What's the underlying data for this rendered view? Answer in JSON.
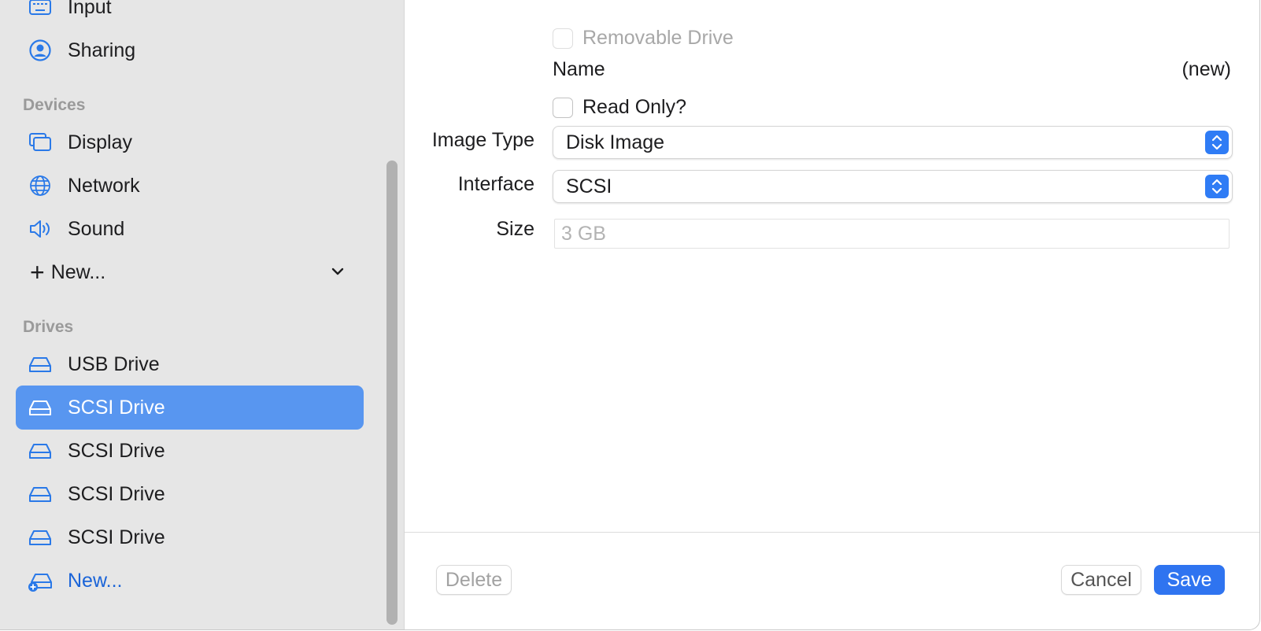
{
  "sidebar": {
    "items_top": [
      {
        "label": "Input",
        "icon": "keyboard-icon"
      },
      {
        "label": "Sharing",
        "icon": "person-circle-icon"
      }
    ],
    "devices_header": "Devices",
    "devices": [
      {
        "label": "Display",
        "icon": "display-icon"
      },
      {
        "label": "Network",
        "icon": "globe-icon"
      },
      {
        "label": "Sound",
        "icon": "speaker-icon"
      }
    ],
    "new_device_label": "New...",
    "drives_header": "Drives",
    "drives": [
      {
        "label": "USB Drive",
        "icon": "drive-icon",
        "selected": false
      },
      {
        "label": "SCSI Drive",
        "icon": "drive-icon",
        "selected": true
      },
      {
        "label": "SCSI Drive",
        "icon": "drive-icon",
        "selected": false
      },
      {
        "label": "SCSI Drive",
        "icon": "drive-icon",
        "selected": false
      },
      {
        "label": "SCSI Drive",
        "icon": "drive-icon",
        "selected": false
      }
    ],
    "new_drive_label": "New..."
  },
  "form": {
    "removable_label": "Removable Drive",
    "removable_checked": false,
    "name_label": "Name",
    "name_value": "(new)",
    "read_only_label": "Read Only?",
    "read_only_checked": false,
    "image_type_label": "Image Type",
    "image_type_value": "Disk Image",
    "interface_label": "Interface",
    "interface_value": "SCSI",
    "size_label": "Size",
    "size_placeholder": "3 GB"
  },
  "buttons": {
    "delete": "Delete",
    "cancel": "Cancel",
    "save": "Save"
  },
  "colors": {
    "accent": "#2f74f0",
    "selected_row": "#5896f0",
    "link_blue": "#1a64d8"
  }
}
